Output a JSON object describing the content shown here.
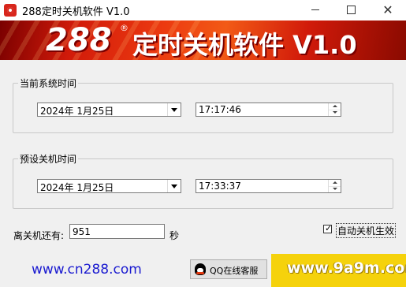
{
  "window": {
    "title": "288定时关机软件 V1.0",
    "controls": {
      "minimize": "",
      "maximize": "",
      "close": "✕"
    }
  },
  "banner": {
    "brand": "288",
    "reg_mark": "®",
    "title": "定时关机软件 V1.0"
  },
  "current_time_group": {
    "label": "当前系统时间",
    "date": "2024年 1月25日",
    "time": "17:17:46"
  },
  "shutdown_time_group": {
    "label": "预设关机时间",
    "date": "2024年 1月25日",
    "time": "17:33:37"
  },
  "countdown": {
    "label": "离关机还有:",
    "value": "951",
    "unit": "秒"
  },
  "auto_shutdown": {
    "label": "自动关机生效",
    "checked": true,
    "check_mark": "✓"
  },
  "footer": {
    "website": "www.cn288.com",
    "qq_button": "QQ在线客服"
  },
  "watermark": "www.9a9m.com",
  "colors": {
    "banner_red": "#d11a0a",
    "link_blue": "#1a1ad0",
    "watermark_yellow": "#f5d20c"
  }
}
